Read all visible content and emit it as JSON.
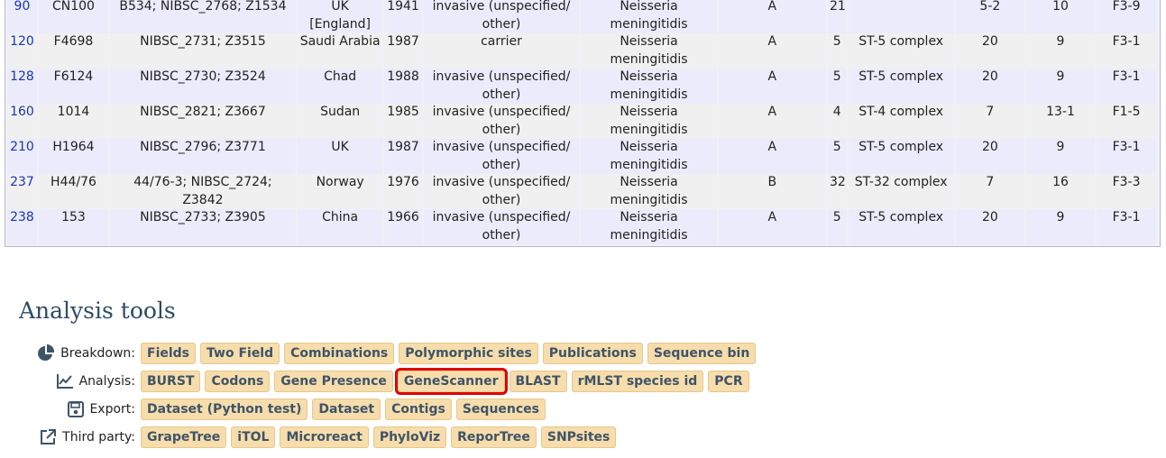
{
  "table": {
    "rows": [
      {
        "id": "90",
        "name": "CN100",
        "aliases": "B534; NIBSC_2768; Z1534",
        "country": "UK [England]",
        "year": "1941",
        "disease": "invasive (unspecified/ other)",
        "species": "Neisseria meningitidis",
        "serogroup": "A",
        "st": "21",
        "complex": "",
        "pora_vr1": "5-2",
        "pora_vr2": "10",
        "feta": "F3-9"
      },
      {
        "id": "120",
        "name": "F4698",
        "aliases": "NIBSC_2731; Z3515",
        "country": "Saudi Arabia",
        "year": "1987",
        "disease": "carrier",
        "species": "Neisseria meningitidis",
        "serogroup": "A",
        "st": "5",
        "complex": "ST-5 complex",
        "pora_vr1": "20",
        "pora_vr2": "9",
        "feta": "F3-1"
      },
      {
        "id": "128",
        "name": "F6124",
        "aliases": "NIBSC_2730; Z3524",
        "country": "Chad",
        "year": "1988",
        "disease": "invasive (unspecified/ other)",
        "species": "Neisseria meningitidis",
        "serogroup": "A",
        "st": "5",
        "complex": "ST-5 complex",
        "pora_vr1": "20",
        "pora_vr2": "9",
        "feta": "F3-1"
      },
      {
        "id": "160",
        "name": "1014",
        "aliases": "NIBSC_2821; Z3667",
        "country": "Sudan",
        "year": "1985",
        "disease": "invasive (unspecified/ other)",
        "species": "Neisseria meningitidis",
        "serogroup": "A",
        "st": "4",
        "complex": "ST-4 complex",
        "pora_vr1": "7",
        "pora_vr2": "13-1",
        "feta": "F1-5"
      },
      {
        "id": "210",
        "name": "H1964",
        "aliases": "NIBSC_2796; Z3771",
        "country": "UK",
        "year": "1987",
        "disease": "invasive (unspecified/ other)",
        "species": "Neisseria meningitidis",
        "serogroup": "A",
        "st": "5",
        "complex": "ST-5 complex",
        "pora_vr1": "20",
        "pora_vr2": "9",
        "feta": "F3-1"
      },
      {
        "id": "237",
        "name": "H44/76",
        "aliases": "44/76-3; NIBSC_2724; Z3842",
        "country": "Norway",
        "year": "1976",
        "disease": "invasive (unspecified/ other)",
        "species": "Neisseria meningitidis",
        "serogroup": "B",
        "st": "32",
        "complex": "ST-32 complex",
        "pora_vr1": "7",
        "pora_vr2": "16",
        "feta": "F3-3"
      },
      {
        "id": "238",
        "name": "153",
        "aliases": "NIBSC_2733; Z3905",
        "country": "China",
        "year": "1966",
        "disease": "invasive (unspecified/ other)",
        "species": "Neisseria meningitidis",
        "serogroup": "A",
        "st": "5",
        "complex": "ST-5 complex",
        "pora_vr1": "20",
        "pora_vr2": "9",
        "feta": "F3-1"
      }
    ]
  },
  "analysis_tools": {
    "title": "Analysis tools",
    "breakdown": {
      "label": "Breakdown:",
      "icon": "pie-chart-icon",
      "buttons": [
        "Fields",
        "Two Field",
        "Combinations",
        "Polymorphic sites",
        "Publications",
        "Sequence bin"
      ]
    },
    "analysis": {
      "label": "Analysis:",
      "icon": "line-chart-icon",
      "buttons": [
        "BURST",
        "Codons",
        "Gene Presence",
        "GeneScanner",
        "BLAST",
        "rMLST species id",
        "PCR"
      ],
      "highlighted": "GeneScanner"
    },
    "export": {
      "label": "Export:",
      "icon": "save-icon",
      "buttons": [
        "Dataset (Python test)",
        "Dataset",
        "Contigs",
        "Sequences"
      ]
    },
    "third_party": {
      "label": "Third party:",
      "icon": "external-link-icon",
      "buttons": [
        "GrapeTree",
        "iTOL",
        "Microreact",
        "PhyloViz",
        "ReporTree",
        "SNPsites"
      ]
    }
  },
  "colors": {
    "button_bg": "#f7ddab",
    "button_text": "#3e5468",
    "highlight": "#e00000",
    "title": "#2e4a66",
    "link": "#1a36b4"
  }
}
